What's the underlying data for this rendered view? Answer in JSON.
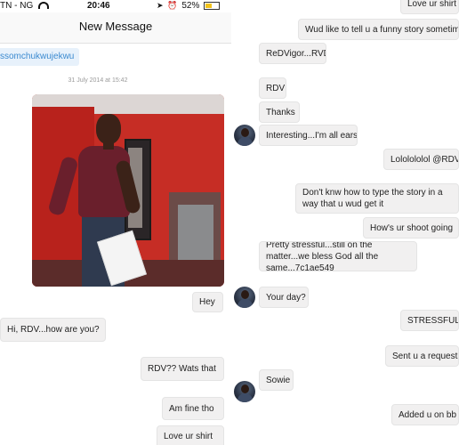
{
  "status_bar": {
    "carrier": "TN - NG",
    "time": "20:46",
    "battery": "52%",
    "battery_level": 0.52
  },
  "header": {
    "title": "New Message"
  },
  "recipient": "ssomchukwujekwu",
  "timestamp": "31 July 2014 at 15:42",
  "left_messages": [
    {
      "text": "Hey",
      "side": "sent"
    },
    {
      "text": "Hi, RDV...how are you?",
      "side": "received"
    },
    {
      "text": "RDV?? Wats that",
      "side": "sent"
    },
    {
      "text": "Am fine tho",
      "side": "sent"
    },
    {
      "text": "Love ur shirt",
      "side": "sent"
    }
  ],
  "right_messages": [
    {
      "text": "Love ur shirt",
      "side": "sent"
    },
    {
      "text": "Wud like to tell u a funny story sometime",
      "side": "sent"
    },
    {
      "text": "ReDVigor...RVD",
      "side": "received"
    },
    {
      "text": "RDV",
      "side": "received"
    },
    {
      "text": "Thanks",
      "side": "received"
    },
    {
      "text": "Interesting...I'm all ears",
      "side": "received"
    },
    {
      "text": "Lololololol @RDV",
      "side": "sent"
    },
    {
      "text": "Don't knw how to type the story in a way that u wud get it",
      "side": "sent"
    },
    {
      "text": "How's ur shoot going",
      "side": "sent"
    },
    {
      "text": "Pretty stressful...still on the matter...we bless God all the same...7c1ae549",
      "side": "received"
    },
    {
      "text": "Your day?",
      "side": "received"
    },
    {
      "text": "STRESSFUL",
      "side": "sent"
    },
    {
      "text": "Sent u a request",
      "side": "sent"
    },
    {
      "text": "Sowie",
      "side": "received"
    },
    {
      "text": "Added u on bb",
      "side": "sent"
    }
  ],
  "icons": [
    "wifi-icon",
    "location-icon",
    "alarm-icon",
    "battery-icon",
    "avatar"
  ]
}
